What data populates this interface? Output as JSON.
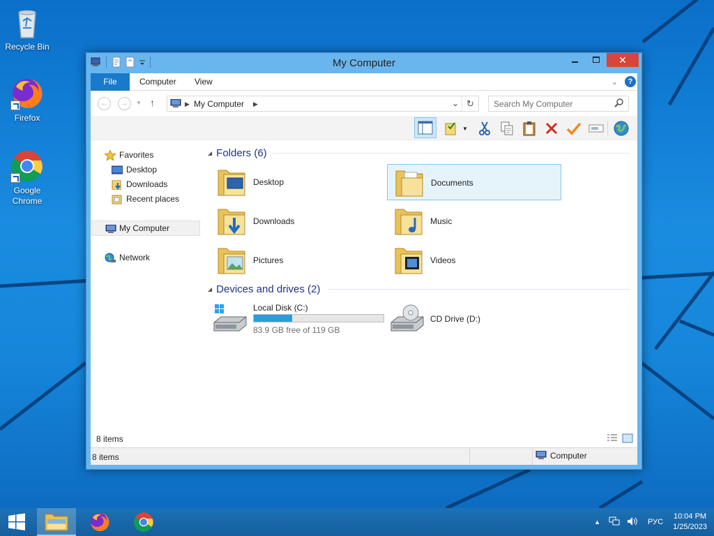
{
  "desktop": {
    "icons": [
      {
        "label": "Recycle Bin"
      },
      {
        "label": "Firefox"
      },
      {
        "label": "Google Chrome"
      }
    ]
  },
  "window": {
    "title": "My Computer",
    "ribbon_tabs": [
      "File",
      "Computer",
      "View"
    ],
    "address": {
      "location": "My Computer"
    },
    "search": {
      "placeholder": "Search My Computer"
    }
  },
  "nav": {
    "favorites": "Favorites",
    "favorite_items": [
      "Desktop",
      "Downloads",
      "Recent places"
    ],
    "my_computer": "My Computer",
    "network": "Network"
  },
  "folders": {
    "header": "Folders (6)",
    "items": [
      {
        "name": "Desktop",
        "icon": "desktop-folder-icon"
      },
      {
        "name": "Documents",
        "icon": "documents-folder-icon",
        "selected": true
      },
      {
        "name": "Downloads",
        "icon": "downloads-folder-icon"
      },
      {
        "name": "Music",
        "icon": "music-folder-icon"
      },
      {
        "name": "Pictures",
        "icon": "pictures-folder-icon"
      },
      {
        "name": "Videos",
        "icon": "videos-folder-icon"
      }
    ]
  },
  "devices": {
    "header": "Devices and drives (2)",
    "items": [
      {
        "name": "Local Disk (C:)",
        "free_text": "83.9 GB free of 119 GB",
        "used_fraction": 0.295
      },
      {
        "name": "CD Drive (D:)"
      }
    ]
  },
  "status": {
    "items_count": "8 items",
    "items_count_bar": "8 items",
    "location": "Computer"
  },
  "taskbar": {
    "language": "РУС",
    "time": "10:04 PM",
    "date": "1/25/2023"
  },
  "colors": {
    "accent": "#1979ca",
    "selection": "#e5f3fb",
    "close_button": "#d9453b",
    "progress": "#26a0da"
  }
}
